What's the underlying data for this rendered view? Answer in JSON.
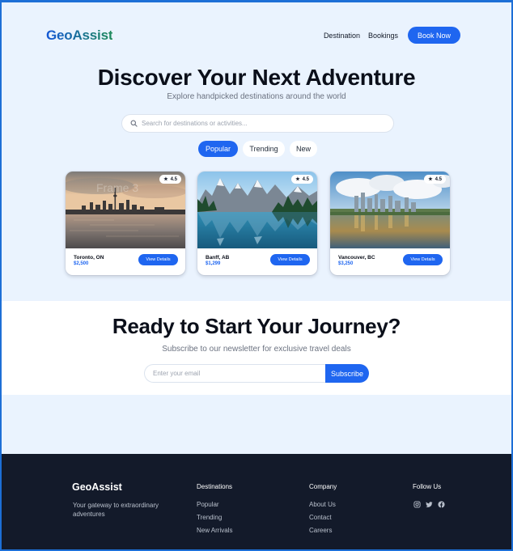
{
  "header": {
    "logo": "GeoAssist",
    "nav": [
      "Destination",
      "Bookings"
    ],
    "cta": "Book Now"
  },
  "hero": {
    "title": "Discover Your Next Adventure",
    "subtitle": "Explore handpicked destinations around the world",
    "search_placeholder": "Search for destinations or activities...",
    "tabs": [
      {
        "label": "Popular",
        "active": true
      },
      {
        "label": "Trending",
        "active": false
      },
      {
        "label": "New",
        "active": false
      }
    ]
  },
  "cards": [
    {
      "name": "Toronto, ON",
      "price": "$2,500",
      "rating": "4.5",
      "button": "View Details",
      "overlay_text": "Frame 3"
    },
    {
      "name": "Banff, AB",
      "price": "$1,299",
      "rating": "4.5",
      "button": "View Details"
    },
    {
      "name": "Vancouver, BC",
      "price": "$3,250",
      "rating": "4.5",
      "button": "View Details"
    }
  ],
  "newsletter": {
    "title": "Ready to Start Your Journey?",
    "subtitle": "Subscribe to our newsletter for exclusive travel deals",
    "placeholder": "Enter your email",
    "button": "Subscribe"
  },
  "footer": {
    "brand": "GeoAssist",
    "tagline": "Your gateway to extraordinary adventures",
    "destinations": {
      "heading": "Destinations",
      "links": [
        "Popular",
        "Trending",
        "New Arrivals"
      ]
    },
    "company": {
      "heading": "Company",
      "links": [
        "About Us",
        "Contact",
        "Careers"
      ]
    },
    "follow": {
      "heading": "Follow Us",
      "icons": [
        "instagram-icon",
        "twitter-icon",
        "facebook-icon"
      ]
    }
  },
  "colors": {
    "accent": "#1f66f0",
    "page_bg": "#eaf3fe",
    "footer_bg": "#131a2a"
  }
}
